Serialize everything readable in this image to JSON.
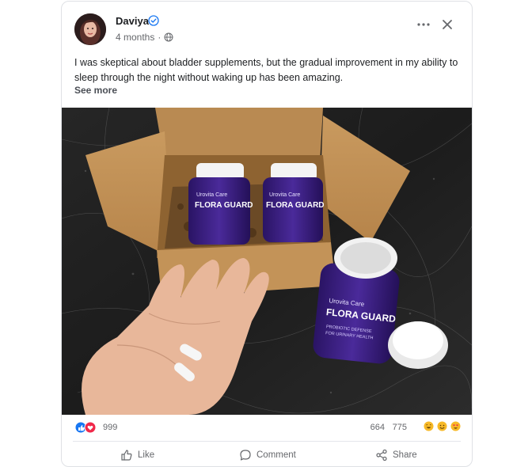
{
  "post": {
    "author": "Daviya",
    "time": "4 months",
    "text": "I was skeptical about bladder supplements, but the gradual improvement in my ability to sleep through the night without waking up has been amazing.",
    "see_more": "See more"
  },
  "photo": {
    "brand": "Urovita Care",
    "product_name": "FLORA GUARD",
    "product_tagline": "PROBIOTIC DEFENSE",
    "product_tagline2": "FOR URINARY HEALTH"
  },
  "stats": {
    "reactions": "999",
    "comments": "664",
    "shares": "775"
  },
  "actions": {
    "like": "Like",
    "comment": "Comment",
    "share": "Share"
  },
  "colors": {
    "verified": "#1877f2",
    "like_blue": "#1877f2",
    "love_red": "#f0284a",
    "bottle_purple": "#3b1f78"
  }
}
